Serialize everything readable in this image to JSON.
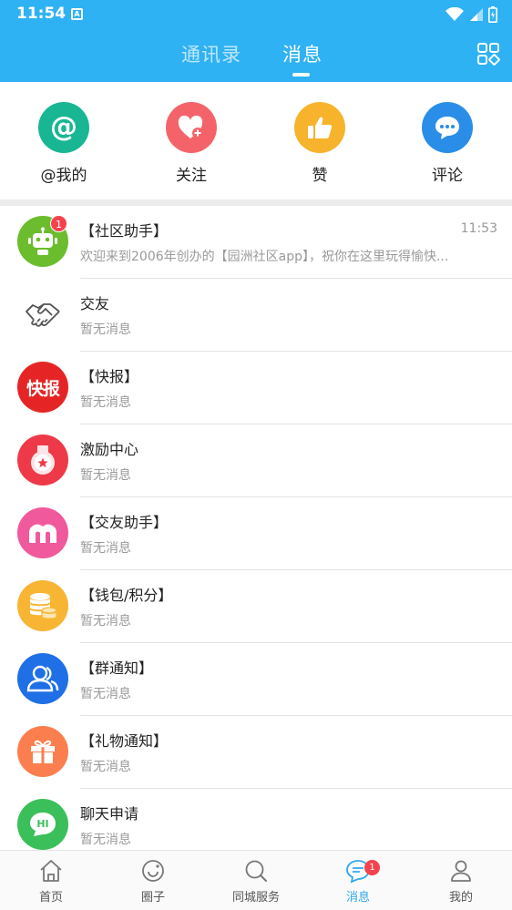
{
  "status_bar": {
    "time": "11:54",
    "notif_icon": "A"
  },
  "header": {
    "tabs": [
      {
        "label": "通讯录",
        "active": false
      },
      {
        "label": "消息",
        "active": true
      }
    ],
    "right_icon": "apps-grid-icon"
  },
  "quick_actions": [
    {
      "label": "@我的",
      "icon": "at-icon",
      "color": "#19b694"
    },
    {
      "label": "关注",
      "icon": "heart-plus-icon",
      "color": "#f5636a"
    },
    {
      "label": "赞",
      "icon": "thumbs-up-icon",
      "color": "#f7b32b"
    },
    {
      "label": "评论",
      "icon": "comment-icon",
      "color": "#2a8de8"
    }
  ],
  "messages": [
    {
      "title": "【社区助手】",
      "subtitle": "欢迎来到2006年创办的【园洲社区app】，祝你在这里玩得愉快...",
      "time": "11:53",
      "badge": "1",
      "icon": "robot-icon",
      "color": "#6cbd2e"
    },
    {
      "title": "交友",
      "subtitle": "暂无消息",
      "icon": "handshake-icon",
      "color": "#ffffff"
    },
    {
      "title": "【快报】",
      "subtitle": "暂无消息",
      "icon": "kuaibao-logo-icon",
      "color": "#e52525",
      "logo_text": "快报"
    },
    {
      "title": "激励中心",
      "subtitle": "暂无消息",
      "icon": "medal-icon",
      "color": "#ee3a48"
    },
    {
      "title": "【交友助手】",
      "subtitle": "暂无消息",
      "icon": "friends-logo-icon",
      "color": "#f0599c"
    },
    {
      "title": "【钱包/积分】",
      "subtitle": "暂无消息",
      "icon": "coins-icon",
      "color": "#f8b533"
    },
    {
      "title": "【群通知】",
      "subtitle": "暂无消息",
      "icon": "group-icon",
      "color": "#1f6fe6"
    },
    {
      "title": "【礼物通知】",
      "subtitle": "暂无消息",
      "icon": "gift-icon",
      "color": "#fb7f4e"
    },
    {
      "title": "聊天申请",
      "subtitle": "暂无消息",
      "icon": "chat-hi-icon",
      "color": "#3bbf5a",
      "logo_text": "HI"
    }
  ],
  "bottom_nav": [
    {
      "label": "首页",
      "icon": "home-icon",
      "active": false
    },
    {
      "label": "圈子",
      "icon": "circle-icon",
      "active": false
    },
    {
      "label": "同城服务",
      "icon": "search-icon",
      "active": false
    },
    {
      "label": "消息",
      "icon": "message-icon",
      "active": true,
      "badge": "1"
    },
    {
      "label": "我的",
      "icon": "profile-icon",
      "active": false
    }
  ]
}
